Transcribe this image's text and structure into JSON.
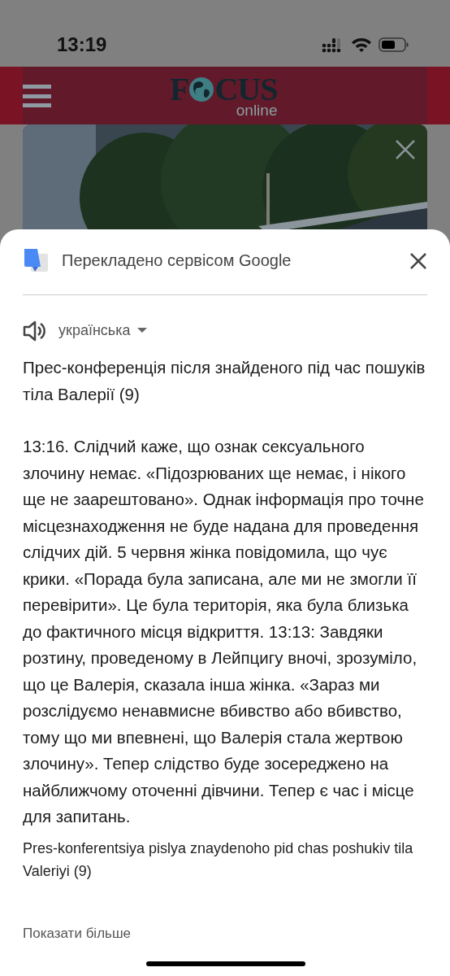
{
  "status_bar": {
    "time": "13:19"
  },
  "site_header": {
    "logo_before": "F",
    "logo_after": "CUS",
    "logo_sub": "online"
  },
  "translation_sheet": {
    "title": "Перекладено сервісом Google",
    "language": "українська",
    "headline": "Прес-конференція після знайденого під час пошуків тіла Валерії (9)",
    "body": "13:16. Слідчий каже, що ознак сексуального злочину немає. «Підозрюваних ще немає, і нікого ще не заарештовано». Однак інформація про точне місцезнаходження не буде надана для проведення слідчих дій. 5 червня жінка повідомила, що чує крики. «Порада була записана, але ми не змогли її перевірити». Це була територія, яка була близька до фактичного місця відкриття. 13:13: Завдяки розтину, проведеному в Лейпцигу вночі, зрозуміло, що це Валерія, сказала інша жінка. «Зараз ми розслідуємо ненавмисне вбивство або вбивство, тому що ми впевнені, що Валерія стала жертвою злочину». Тепер слідство буде зосереджено на найближчому оточенні дівчини. Тепер є час і місце для запитань.",
    "transliteration": "Pres-konferentsiya pislya znaydenoho pid chas poshukiv tila Valeriyi (9)",
    "show_more": "Показати більше"
  }
}
